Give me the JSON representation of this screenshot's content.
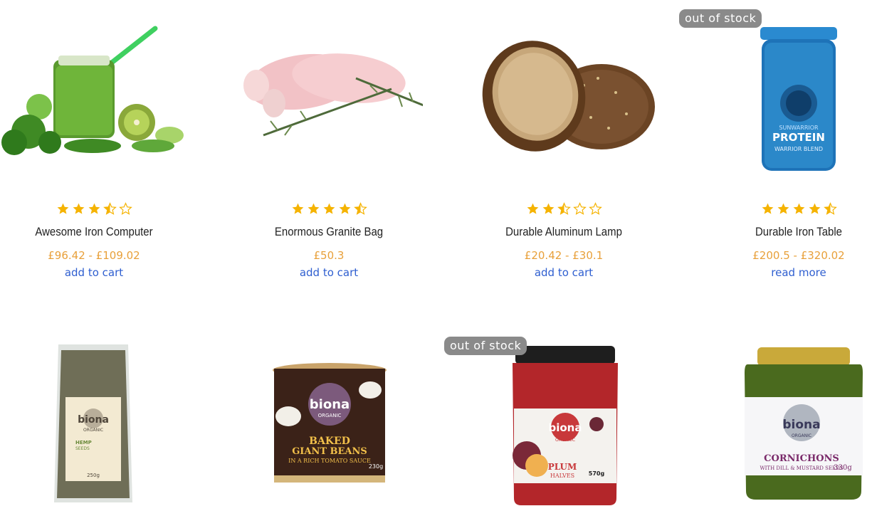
{
  "products": [
    {
      "title": "Awesome Iron Computer",
      "price": "£96.42 - £109.02",
      "action": "add to cart",
      "rating": 3.5,
      "image": "green-smoothie-image"
    },
    {
      "title": "Enormous Granite Bag",
      "price": "£50.3",
      "action": "add to cart",
      "rating": 4.5,
      "image": "chicken-drumsticks-image"
    },
    {
      "title": "Durable Aluminum Lamp",
      "price": "£20.42 - £30.1",
      "action": "add to cart",
      "rating": 2.5,
      "image": "bread-loaf-image"
    },
    {
      "title": "Durable Iron Table",
      "price": "£200.5 - £320.02",
      "action": "read more",
      "rating": 4.5,
      "badge": "out of stock",
      "image": "protein-tub-image"
    },
    {
      "image": "hemp-seeds-bag-image",
      "label": {
        "brand": "biona",
        "sub": "ORGANIC",
        "name": "HEMP",
        "name2": "SEEDS",
        "size": "250g"
      }
    },
    {
      "image": "baked-beans-can-image",
      "label": {
        "brand": "biona",
        "sub": "ORGANIC",
        "name": "BAKED",
        "name2": "GIANT BEANS",
        "name3": "IN A RICH TOMATO SAUCE",
        "size": "230g"
      }
    },
    {
      "image": "plum-jar-image",
      "badge": "out of stock",
      "label": {
        "brand": "biona",
        "sub": "ORGANIC",
        "name": "PLUM",
        "name2": "HALVES",
        "size": "570g"
      }
    },
    {
      "image": "cornichons-jar-image",
      "label": {
        "brand": "biona",
        "sub": "ORGANIC",
        "name": "CORNICHONS",
        "name2": "WITH DILL & MUSTARD SEEDS",
        "size": "330g"
      }
    }
  ],
  "protein_label": {
    "line1": "PROTEIN",
    "line2": "WARRIOR BLEND",
    "brand": "SUNWARRIOR"
  },
  "colors": {
    "price": "#e8a03a",
    "link": "#2f5fd0",
    "star": "#f5b301",
    "badge": "#8a8a8a"
  }
}
